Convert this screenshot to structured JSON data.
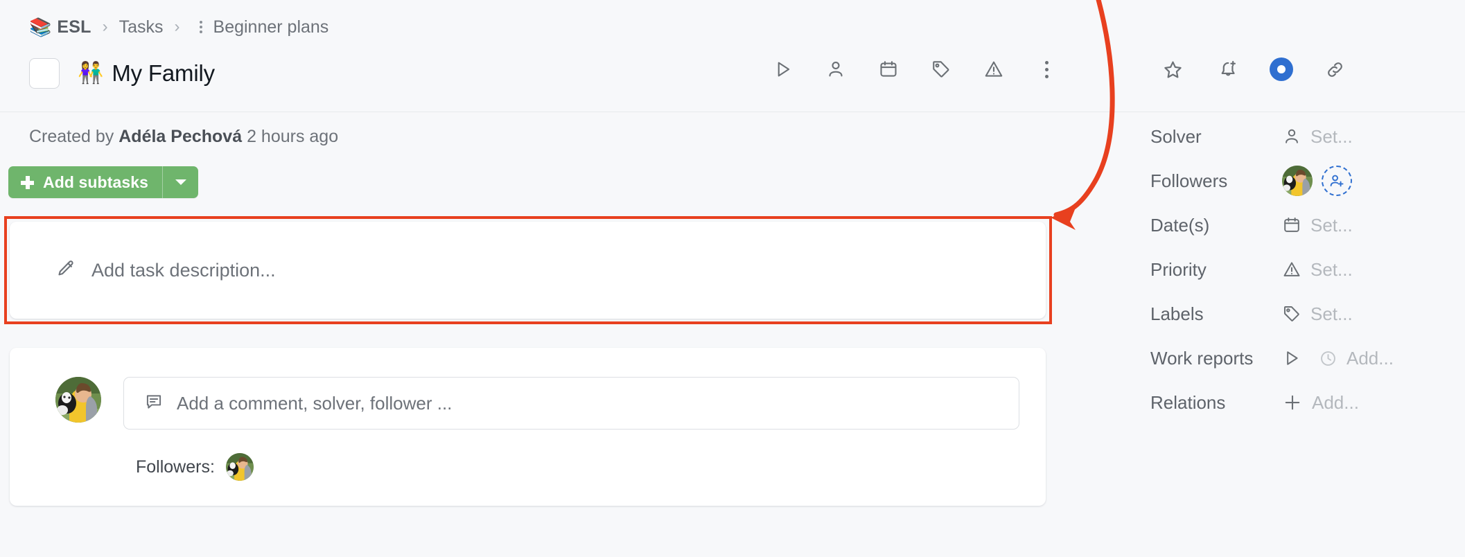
{
  "breadcrumb": {
    "project_emoji": "📚",
    "project": "ESL",
    "sep": "›",
    "section": "Tasks",
    "current": "Beginner plans",
    "overflow_icon": "vertical-dots-icon"
  },
  "task": {
    "emoji": "👫",
    "title": "My Family",
    "checkbox_checked": false,
    "created_prefix": "Created by",
    "created_author": "Adéla Pechová",
    "created_time": "2 hours ago"
  },
  "header_actions": [
    {
      "name": "work-report-play-icon",
      "label": "Work report"
    },
    {
      "name": "solver-person-icon",
      "label": "Solver"
    },
    {
      "name": "dates-calendar-icon",
      "label": "Date(s)"
    },
    {
      "name": "labels-tag-icon",
      "label": "Labels"
    },
    {
      "name": "priority-warning-icon",
      "label": "Priority"
    },
    {
      "name": "more-options-icon",
      "label": "More"
    }
  ],
  "subtasks": {
    "label": "Add subtasks",
    "plus_icon": "plus-icon",
    "caret_icon": "chevron-down-icon",
    "color": "#6fb56c"
  },
  "description": {
    "pencil_icon": "pencil-icon",
    "placeholder": "Add task description...",
    "highlight_color": "#e8401f",
    "highlighted": true
  },
  "comment": {
    "comment_icon": "comment-bubble-icon",
    "placeholder": "Add a comment, solver, follower ...",
    "followers_label": "Followers:",
    "follower_count": 1
  },
  "sidebar": {
    "actions": [
      {
        "name": "favorite-star-icon",
        "label": "Favorite",
        "active": false
      },
      {
        "name": "subscribe-bell-icon",
        "label": "Subscribe",
        "active": false
      },
      {
        "name": "watch-eye-icon",
        "label": "Watching",
        "active": true,
        "color": "#2f6fd0"
      },
      {
        "name": "copy-link-icon",
        "label": "Copy link",
        "active": false
      }
    ],
    "properties": [
      {
        "label": "Solver",
        "icon": "person-icon",
        "value": "Set...",
        "type": "set"
      },
      {
        "label": "Followers",
        "icon": "avatar",
        "value": "",
        "type": "followers"
      },
      {
        "label": "Date(s)",
        "icon": "calendar-icon",
        "value": "Set...",
        "type": "set"
      },
      {
        "label": "Priority",
        "icon": "warning-triangle-icon",
        "value": "Set...",
        "type": "set"
      },
      {
        "label": "Labels",
        "icon": "tag-icon",
        "value": "Set...",
        "type": "set"
      },
      {
        "label": "Work reports",
        "icon": "play-icon",
        "icon2": "clock-icon",
        "value": "Add...",
        "type": "add"
      },
      {
        "label": "Relations",
        "icon": "plus-icon",
        "value": "Add...",
        "type": "add"
      }
    ]
  },
  "annotation": {
    "arrow_color": "#e8401f",
    "points_to": "description-card"
  }
}
